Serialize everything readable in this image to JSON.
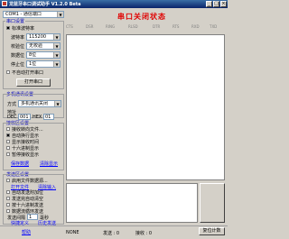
{
  "window": {
    "title": "龙蓝牙串口调试助手 V1.2.0 Beta"
  },
  "port": {
    "selected": "COM1 - 通信端口"
  },
  "port_settings": {
    "title": "串口设置",
    "standard_baud": "标准波特率",
    "baud_label": "波特率",
    "baud_value": "115200",
    "parity_label": "校验位",
    "parity_value": "无校验",
    "databits_label": "数据位",
    "databits_value": "8位",
    "stopbits_label": "停止位",
    "stopbits_value": "1位",
    "auto_open": "不自动打开串口",
    "open_button": "打开串口"
  },
  "status": {
    "text": "串口关闭状态"
  },
  "pins": [
    "CTS",
    "DSR",
    "RING",
    "RLSD",
    "DTR",
    "RTS",
    "RXD",
    "TXD"
  ],
  "multi_send": {
    "title": "多机通讯设置",
    "mode_label": "方式",
    "mode_value": "多机通讯关闭",
    "addr_label": "地址",
    "dec_label": "DEC",
    "dec_value": "001",
    "hex_label": "HEX",
    "hex_value": "01"
  },
  "receive": {
    "title": "接收区设置",
    "opt1": "接收转向文件...",
    "opt2": "自动换行显示",
    "opt3": "显示接收时间",
    "opt4": "十六进制显示",
    "opt5": "暂停接收显示",
    "link_save": "保存数据",
    "link_clear": "清除显示"
  },
  "send": {
    "title": "发送区设置",
    "opt1": "启用文件数据源...",
    "link_open": "打开文件",
    "link_clear": "清除输入",
    "opt2": "自动发送附加位",
    "opt3": "发送完自动清空",
    "opt4": "按十六进制发送",
    "opt5": "数据流循环发送",
    "interval_label": "发送间隔",
    "interval_value": "1",
    "interval_unit": "毫秒",
    "link_shortcut": "快捷定义",
    "link_history": "历史发送"
  },
  "footer": {
    "help": "帮助",
    "status": "NONE",
    "sent": "发送 : 0",
    "recv": "接收 : 0",
    "reset": "复位计数"
  },
  "colors": {
    "title_bar": "#0a246a",
    "status_red": "#e00000",
    "link_blue": "#0000ff",
    "group_blue": "#0000c0"
  }
}
